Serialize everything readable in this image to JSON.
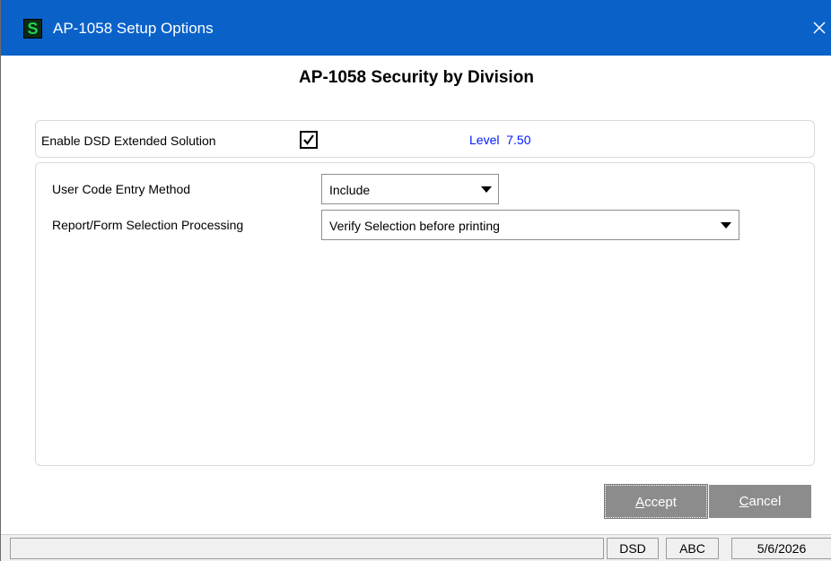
{
  "window": {
    "title": "AP-1058 Setup Options",
    "app_icon_letter": "S",
    "close_glyph": "✕",
    "accent_color": "#0a62c9"
  },
  "heading": "AP-1058 Security by Division",
  "enable": {
    "label": "Enable DSD Extended Solution",
    "checked": true,
    "level_label": "Level",
    "level_value": "7.50"
  },
  "fields": {
    "user_code": {
      "label": "User Code Entry Method",
      "value": "Include"
    },
    "report_form": {
      "label": "Report/Form Selection Processing",
      "value": "Verify Selection before printing"
    }
  },
  "buttons": {
    "accept_hotkey": "A",
    "accept_rest": "ccept",
    "cancel_hotkey": "C",
    "cancel_rest": "ancel"
  },
  "statusbar": {
    "main": "",
    "company": "DSD",
    "user": "ABC",
    "date": "5/6/2026"
  }
}
